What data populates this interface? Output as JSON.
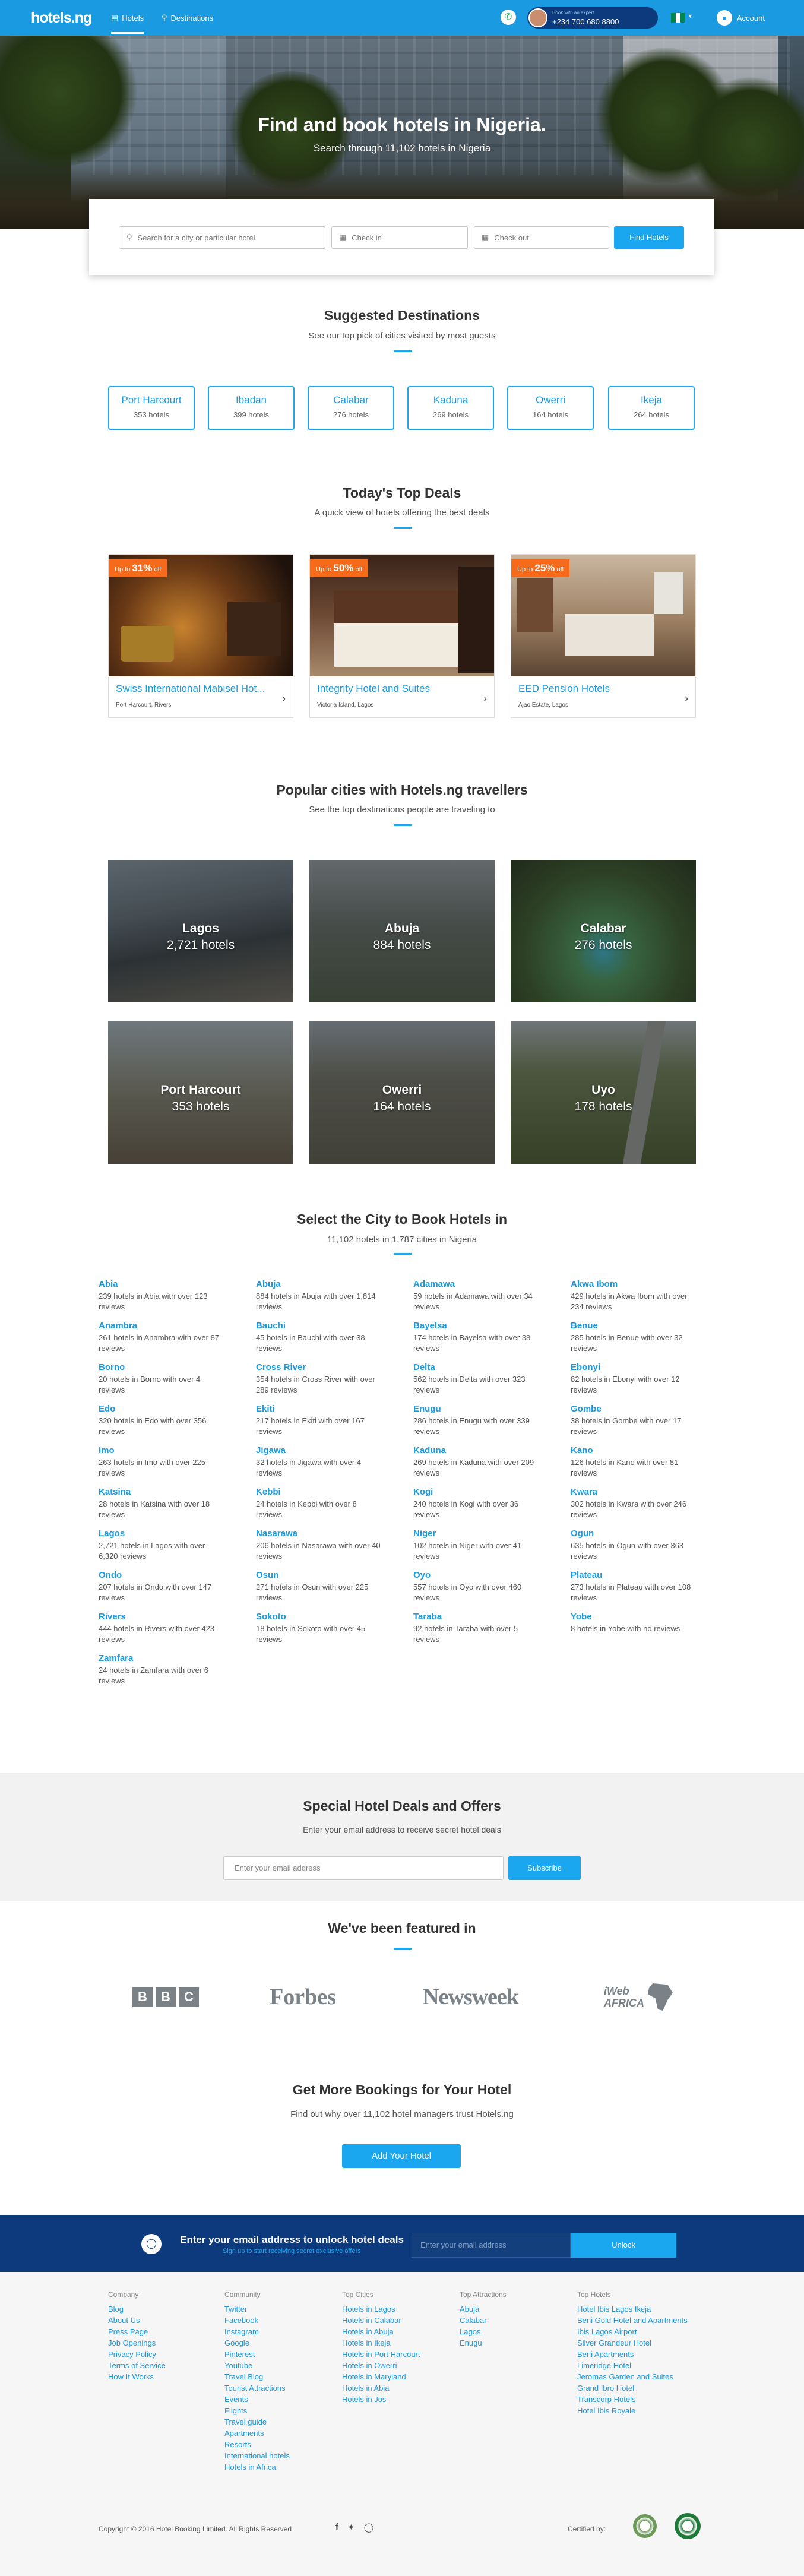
{
  "header": {
    "logo": "hotels.ng",
    "nav": [
      {
        "label": "Hotels",
        "icon": "bed-icon"
      },
      {
        "label": "Destinations",
        "icon": "map-pin-icon"
      }
    ],
    "phone_caption": "Book with an expert",
    "phone_number": "+234 700 680 8800",
    "account": "Account"
  },
  "hero": {
    "title": "Find and book hotels in Nigeria.",
    "subtitle": "Search through 11,102 hotels in Nigeria"
  },
  "search": {
    "city_placeholder": "Search for a city or particular hotel",
    "checkin_placeholder": "Check in",
    "checkout_placeholder": "Check out",
    "button": "Find Hotels"
  },
  "suggested": {
    "title": "Suggested Destinations",
    "subtitle": "See our top pick of cities visited by most guests",
    "items": [
      {
        "name": "Port Harcourt",
        "count": "353 hotels"
      },
      {
        "name": "Ibadan",
        "count": "399 hotels"
      },
      {
        "name": "Calabar",
        "count": "276 hotels"
      },
      {
        "name": "Kaduna",
        "count": "269 hotels"
      },
      {
        "name": "Owerri",
        "count": "164 hotels"
      },
      {
        "name": "Ikeja",
        "count": "264 hotels"
      }
    ]
  },
  "deals": {
    "title": "Today's Top Deals",
    "subtitle": "A quick view of hotels offering the best deals",
    "items": [
      {
        "upto": "Up to",
        "pct": "31%",
        "off": "off",
        "name": "Swiss International Mabisel Hot...",
        "location": "Port Harcourt, Rivers"
      },
      {
        "upto": "Up to",
        "pct": "50%",
        "off": "off",
        "name": "Integrity Hotel and Suites",
        "location": "Victoria Island, Lagos"
      },
      {
        "upto": "Up to",
        "pct": "25%",
        "off": "off",
        "name": "EED Pension Hotels",
        "location": "Ajao Estate, Lagos"
      }
    ]
  },
  "popular": {
    "title": "Popular cities with Hotels.ng travellers",
    "subtitle": "See the top destinations people are traveling to",
    "items": [
      {
        "name": "Lagos",
        "count": "2,721 hotels"
      },
      {
        "name": "Abuja",
        "count": "884 hotels"
      },
      {
        "name": "Calabar",
        "count": "276 hotels"
      },
      {
        "name": "Port Harcourt",
        "count": "353 hotels"
      },
      {
        "name": "Owerri",
        "count": "164 hotels"
      },
      {
        "name": "Uyo",
        "count": "178 hotels"
      }
    ]
  },
  "cities": {
    "title": "Select the City to Book Hotels in",
    "subtitle": "11,102 hotels in 1,787 cities in Nigeria",
    "items": [
      {
        "name": "Abia",
        "desc": "239 hotels in Abia with over 123 reviews"
      },
      {
        "name": "Abuja",
        "desc": "884 hotels in Abuja with over 1,814 reviews"
      },
      {
        "name": "Adamawa",
        "desc": "59 hotels in Adamawa with over 34 reviews"
      },
      {
        "name": "Akwa Ibom",
        "desc": "429 hotels in Akwa Ibom with over 234 reviews"
      },
      {
        "name": "Anambra",
        "desc": "261 hotels in Anambra with over 87 reviews"
      },
      {
        "name": "Bauchi",
        "desc": "45 hotels in Bauchi with over 38 reviews"
      },
      {
        "name": "Bayelsa",
        "desc": "174 hotels in Bayelsa with over 38 reviews"
      },
      {
        "name": "Benue",
        "desc": "285 hotels in Benue with over 32 reviews"
      },
      {
        "name": "Borno",
        "desc": "20 hotels in Borno with over 4 reviews"
      },
      {
        "name": "Cross River",
        "desc": "354 hotels in Cross River with over 289 reviews"
      },
      {
        "name": "Delta",
        "desc": "562 hotels in Delta with over 323 reviews"
      },
      {
        "name": "Ebonyi",
        "desc": "82 hotels in Ebonyi with over 12 reviews"
      },
      {
        "name": "Edo",
        "desc": "320 hotels in Edo with over 356 reviews"
      },
      {
        "name": "Ekiti",
        "desc": "217 hotels in Ekiti with over 167 reviews"
      },
      {
        "name": "Enugu",
        "desc": "286 hotels in Enugu with over 339 reviews"
      },
      {
        "name": "Gombe",
        "desc": "38 hotels in Gombe with over 17 reviews"
      },
      {
        "name": "Imo",
        "desc": "263 hotels in Imo with over 225 reviews"
      },
      {
        "name": "Jigawa",
        "desc": "32 hotels in Jigawa with over 4 reviews"
      },
      {
        "name": "Kaduna",
        "desc": "269 hotels in Kaduna with over 209 reviews"
      },
      {
        "name": "Kano",
        "desc": "126 hotels in Kano with over 81 reviews"
      },
      {
        "name": "Katsina",
        "desc": "28 hotels in Katsina with over 18 reviews"
      },
      {
        "name": "Kebbi",
        "desc": "24 hotels in Kebbi with over 8 reviews"
      },
      {
        "name": "Kogi",
        "desc": "240 hotels in Kogi with over 36 reviews"
      },
      {
        "name": "Kwara",
        "desc": "302 hotels in Kwara with over 246 reviews"
      },
      {
        "name": "Lagos",
        "desc": "2,721 hotels in Lagos with over 6,320 reviews"
      },
      {
        "name": "Nasarawa",
        "desc": "206 hotels in Nasarawa with over 40 reviews"
      },
      {
        "name": "Niger",
        "desc": "102 hotels in Niger with over 41 reviews"
      },
      {
        "name": "Ogun",
        "desc": "635 hotels in Ogun with over 363 reviews"
      },
      {
        "name": "Ondo",
        "desc": "207 hotels in Ondo with over 147 reviews"
      },
      {
        "name": "Osun",
        "desc": "271 hotels in Osun with over 225 reviews"
      },
      {
        "name": "Oyo",
        "desc": "557 hotels in Oyo with over 460 reviews"
      },
      {
        "name": "Plateau",
        "desc": "273 hotels in Plateau with over 108 reviews"
      },
      {
        "name": "Rivers",
        "desc": "444 hotels in Rivers with over 423 reviews"
      },
      {
        "name": "Sokoto",
        "desc": "18 hotels in Sokoto with over 45 reviews"
      },
      {
        "name": "Taraba",
        "desc": "92 hotels in Taraba with over 5 reviews"
      },
      {
        "name": "Yobe",
        "desc": "8 hotels in Yobe with no reviews"
      },
      {
        "name": "Zamfara",
        "desc": "24 hotels in Zamfara with over 6 reviews"
      }
    ]
  },
  "newsletter": {
    "title": "Special Hotel Deals and Offers",
    "subtitle": "Enter your email address to receive secret hotel deals",
    "placeholder": "Enter your email address",
    "button": "Subscribe"
  },
  "featured": {
    "title": "We've been featured in",
    "logos": [
      "BBC",
      "Forbes",
      "Newsweek",
      "iWeb AFRICA"
    ]
  },
  "bookings": {
    "title": "Get More Bookings for Your Hotel",
    "subtitle": "Find out why over 11,102 hotel managers trust Hotels.ng",
    "button": "Add Your Hotel"
  },
  "unlock": {
    "title": "Enter your email address to unlock hotel deals",
    "subtitle": "Sign up to start receiving secret exclusive offers",
    "placeholder": "Enter your email address",
    "button": "Unlock"
  },
  "footer": {
    "columns": [
      {
        "title": "Company",
        "links": [
          "Blog",
          "About Us",
          "Press Page",
          "Job Openings",
          "Privacy Policy",
          "Terms of Service",
          "How It Works"
        ]
      },
      {
        "title": "Community",
        "links": [
          "Twitter",
          "Facebook",
          "Instagram",
          "Google",
          "Pinterest",
          "Youtube",
          "Travel Blog",
          "Tourist Attractions",
          "Events",
          "Flights",
          "Travel guide",
          "Apartments",
          "Resorts",
          "International hotels",
          "Hotels in Africa"
        ]
      },
      {
        "title": "Top Cities",
        "links": [
          "Hotels in Lagos",
          "Hotels in Calabar",
          "Hotels in Abuja",
          "Hotels in Ikeja",
          "Hotels in Port Harcourt",
          "Hotels in Owerri",
          "Hotels in Maryland",
          "Hotels in Abia",
          "Hotels in Jos"
        ]
      },
      {
        "title": "Top Attractions",
        "links": [
          "Abuja",
          "Calabar",
          "Lagos",
          "Enugu"
        ]
      },
      {
        "title": "Top Hotels",
        "links": [
          "Hotel Ibis Lagos Ikeja",
          "Beni Gold Hotel and Apartments",
          "Ibis Lagos Airport",
          "Silver Grandeur Hotel",
          "Beni Apartments",
          "Limeridge Hotel",
          "Jeromas Garden and Suites",
          "Grand Ibro Hotel",
          "Transcorp Hotels",
          "Hotel Ibis Royale"
        ]
      }
    ],
    "copyright": "Copyright © 2016 Hotel Booking Limited. All Rights Reserved",
    "social": [
      "facebook-icon",
      "twitter-icon",
      "instagram-icon"
    ],
    "certified": "Certified by:"
  },
  "colors": {
    "brand": "#1a9ae0",
    "accent": "#1aa7f0",
    "dark": "#0c3a7d",
    "deal_badge": "#f56a1b"
  }
}
